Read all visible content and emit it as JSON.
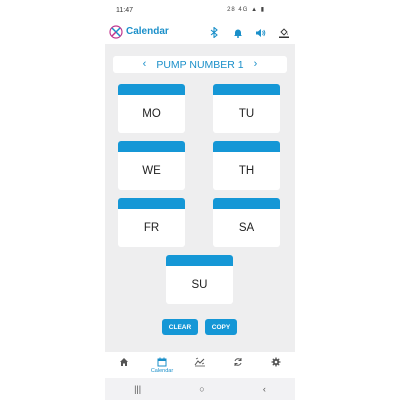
{
  "status_bar": {
    "time": "11:47",
    "icons_text": "28 4G ▲ ▮"
  },
  "app_bar": {
    "title": "Calendar",
    "icons": [
      "bluetooth-icon",
      "alarm-bell-icon",
      "volume-icon",
      "fill-bucket-icon"
    ]
  },
  "pump": {
    "name": "PUMP NUMBER 1",
    "prev_arrow": "‹",
    "next_arrow": "›"
  },
  "days": [
    {
      "label": "MO"
    },
    {
      "label": "TU"
    },
    {
      "label": "WE"
    },
    {
      "label": "TH"
    },
    {
      "label": "FR"
    },
    {
      "label": "SA"
    },
    {
      "label": "SU"
    }
  ],
  "buttons": {
    "clear": "CLEAR",
    "copy": "COPY"
  },
  "bottom_nav": {
    "items": [
      {
        "icon": "home-icon",
        "label": ""
      },
      {
        "icon": "calendar-icon",
        "label": "Calendar",
        "active": true
      },
      {
        "icon": "chart-icon",
        "label": ""
      },
      {
        "icon": "sync-icon",
        "label": ""
      },
      {
        "icon": "settings-icon",
        "label": ""
      }
    ]
  },
  "system_nav": {
    "recents": "|||",
    "home": "○",
    "back": "‹"
  },
  "colors": {
    "accent": "#1a8fc9",
    "card_bar": "#1597d6",
    "background": "#eeeeef"
  }
}
